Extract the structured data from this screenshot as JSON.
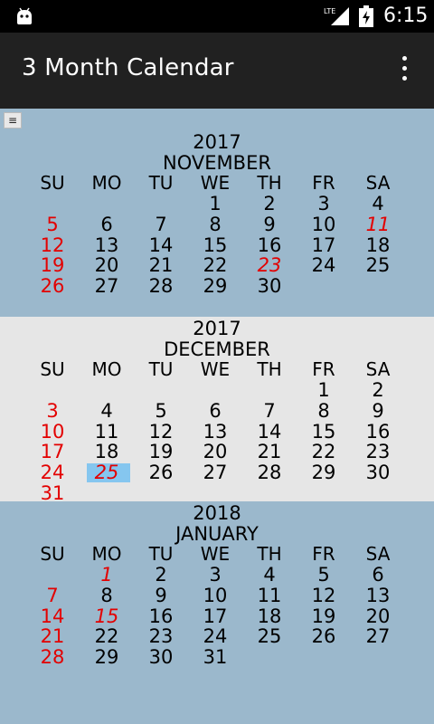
{
  "status_bar": {
    "network": "LTE",
    "time": "6:15"
  },
  "app_bar": {
    "title": "3 Month Calendar"
  },
  "menu_button": {
    "glyph": "≡"
  },
  "colors": {
    "holiday_red": "#e30000",
    "selected_bg": "#85c6ef",
    "month_bg_blue": "#9bb8cc",
    "month_bg_gray": "#e6e6e6"
  },
  "weekday_headers": [
    "SU",
    "MO",
    "TU",
    "WE",
    "TH",
    "FR",
    "SA"
  ],
  "months": [
    {
      "year": "2017",
      "name": "NOVEMBER",
      "weeks": [
        [
          "",
          "",
          "",
          "1",
          "2",
          "3",
          "4"
        ],
        [
          "5",
          "6",
          "7",
          "8",
          "9",
          "10",
          "11"
        ],
        [
          "12",
          "13",
          "14",
          "15",
          "16",
          "17",
          "18"
        ],
        [
          "19",
          "20",
          "21",
          "22",
          "23",
          "24",
          "25"
        ],
        [
          "26",
          "27",
          "28",
          "29",
          "30",
          "",
          ""
        ]
      ],
      "holidays": [
        "11",
        "23"
      ],
      "selected": ""
    },
    {
      "year": "2017",
      "name": "DECEMBER",
      "weeks": [
        [
          "",
          "",
          "",
          "",
          "",
          "1",
          "2"
        ],
        [
          "3",
          "4",
          "5",
          "6",
          "7",
          "8",
          "9"
        ],
        [
          "10",
          "11",
          "12",
          "13",
          "14",
          "15",
          "16"
        ],
        [
          "17",
          "18",
          "19",
          "20",
          "21",
          "22",
          "23"
        ],
        [
          "24",
          "25",
          "26",
          "27",
          "28",
          "29",
          "30"
        ],
        [
          "31",
          "",
          "",
          "",
          "",
          "",
          ""
        ]
      ],
      "holidays": [
        "25"
      ],
      "selected": "25"
    },
    {
      "year": "2018",
      "name": "JANUARY",
      "weeks": [
        [
          "",
          "1",
          "2",
          "3",
          "4",
          "5",
          "6"
        ],
        [
          "7",
          "8",
          "9",
          "10",
          "11",
          "12",
          "13"
        ],
        [
          "14",
          "15",
          "16",
          "17",
          "18",
          "19",
          "20"
        ],
        [
          "21",
          "22",
          "23",
          "24",
          "25",
          "26",
          "27"
        ],
        [
          "28",
          "29",
          "30",
          "31",
          "",
          "",
          ""
        ]
      ],
      "holidays": [
        "1",
        "15"
      ],
      "selected": ""
    }
  ]
}
